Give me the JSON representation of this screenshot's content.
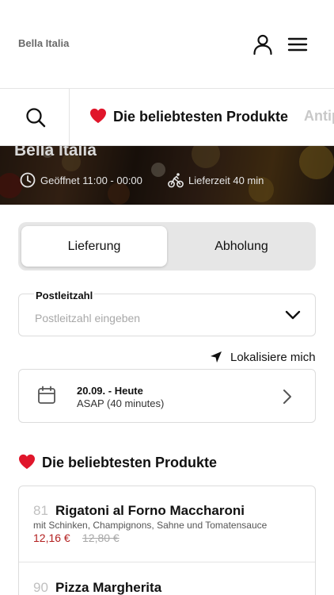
{
  "header": {
    "brand": "Bella Italia",
    "user_icon": "user-icon",
    "menu_icon": "hamburger-menu-icon"
  },
  "category_bar": {
    "search_icon": "search-icon",
    "tabs": [
      {
        "label": "Die beliebtesten Produkte",
        "icon": "heart-icon",
        "active": true
      },
      {
        "label": "Antip",
        "active": false
      }
    ]
  },
  "hero": {
    "restaurant_name": "Bella Italia",
    "opening_hours": "Geöffnet 11:00 - 00:00",
    "delivery_time": "Lieferzeit 40 min"
  },
  "order_type": {
    "options": [
      "Lieferung",
      "Abholung"
    ],
    "selected": "Lieferung"
  },
  "postal_code": {
    "label": "Postleitzahl",
    "placeholder": "Postleitzahl eingeben",
    "value": ""
  },
  "locate": {
    "label": "Lokalisiere mich"
  },
  "date_time": {
    "date": "20.09. - Heute",
    "time": "ASAP (40 minutes)"
  },
  "section": {
    "title": "Die beliebtesten Produkte"
  },
  "products": [
    {
      "number": "81",
      "name": "Rigatoni al Forno Maccharoni",
      "description": "mit Schinken, Champignons, Sahne und Tomatensauce",
      "price": "12,16 €",
      "old_price": "12,80 €"
    },
    {
      "number": "90",
      "name": "Pizza Margherita"
    }
  ],
  "colors": {
    "accent_heart": "#e0162b",
    "price_red": "#b32020",
    "toggle_bg": "#e6e6e6",
    "border": "#dcdcdc"
  }
}
